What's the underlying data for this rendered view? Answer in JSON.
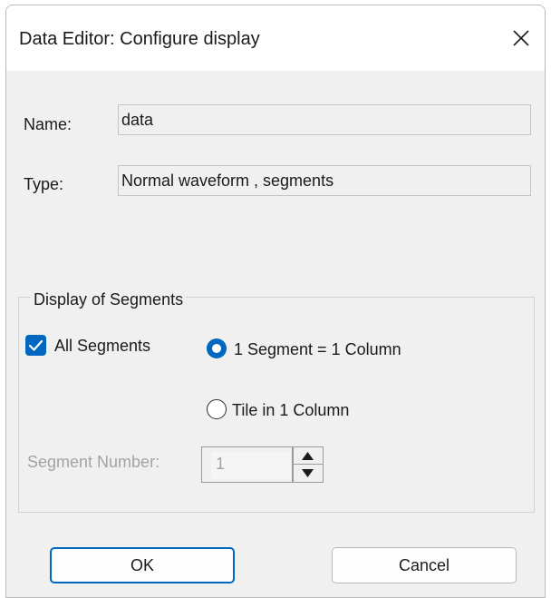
{
  "window": {
    "title": "Data Editor: Configure display",
    "close_icon": "close-icon"
  },
  "fields": {
    "name_label": "Name:",
    "name_value": "data",
    "type_label": "Type:",
    "type_value": "Normal waveform , segments"
  },
  "segments_group": {
    "title": "Display of Segments",
    "all_segments": {
      "label": "All Segments",
      "checked": true
    },
    "radio_one_segment": {
      "label": "1 Segment = 1 Column",
      "selected": true
    },
    "radio_tile": {
      "label": "Tile in 1 Column",
      "selected": false
    },
    "segment_number": {
      "label": "Segment Number:",
      "value": "1",
      "enabled": false
    }
  },
  "buttons": {
    "ok_label": "OK",
    "cancel_label": "Cancel"
  },
  "colors": {
    "accent": "#0067c0",
    "dialog_background": "#f0f0f0",
    "disabled_text": "#a3a3a3"
  }
}
